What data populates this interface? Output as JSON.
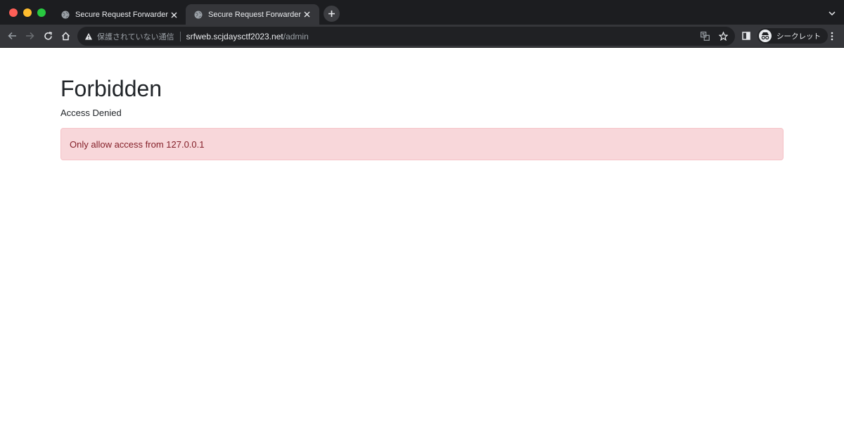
{
  "browser": {
    "tabs": [
      {
        "title": "Secure Request Forwarder",
        "active": false
      },
      {
        "title": "Secure Request Forwarder",
        "active": true
      }
    ],
    "address_bar": {
      "security_text": "保護されていない通信",
      "url_host": "srfweb.scjdaysctf2023.net",
      "url_path": "/admin"
    },
    "profile_label": "シークレット"
  },
  "page": {
    "heading": "Forbidden",
    "subtext": "Access Denied",
    "alert": {
      "message": "Only allow access from 127.0.0.1",
      "background": "#f8d7da",
      "text_color": "#842029"
    }
  }
}
